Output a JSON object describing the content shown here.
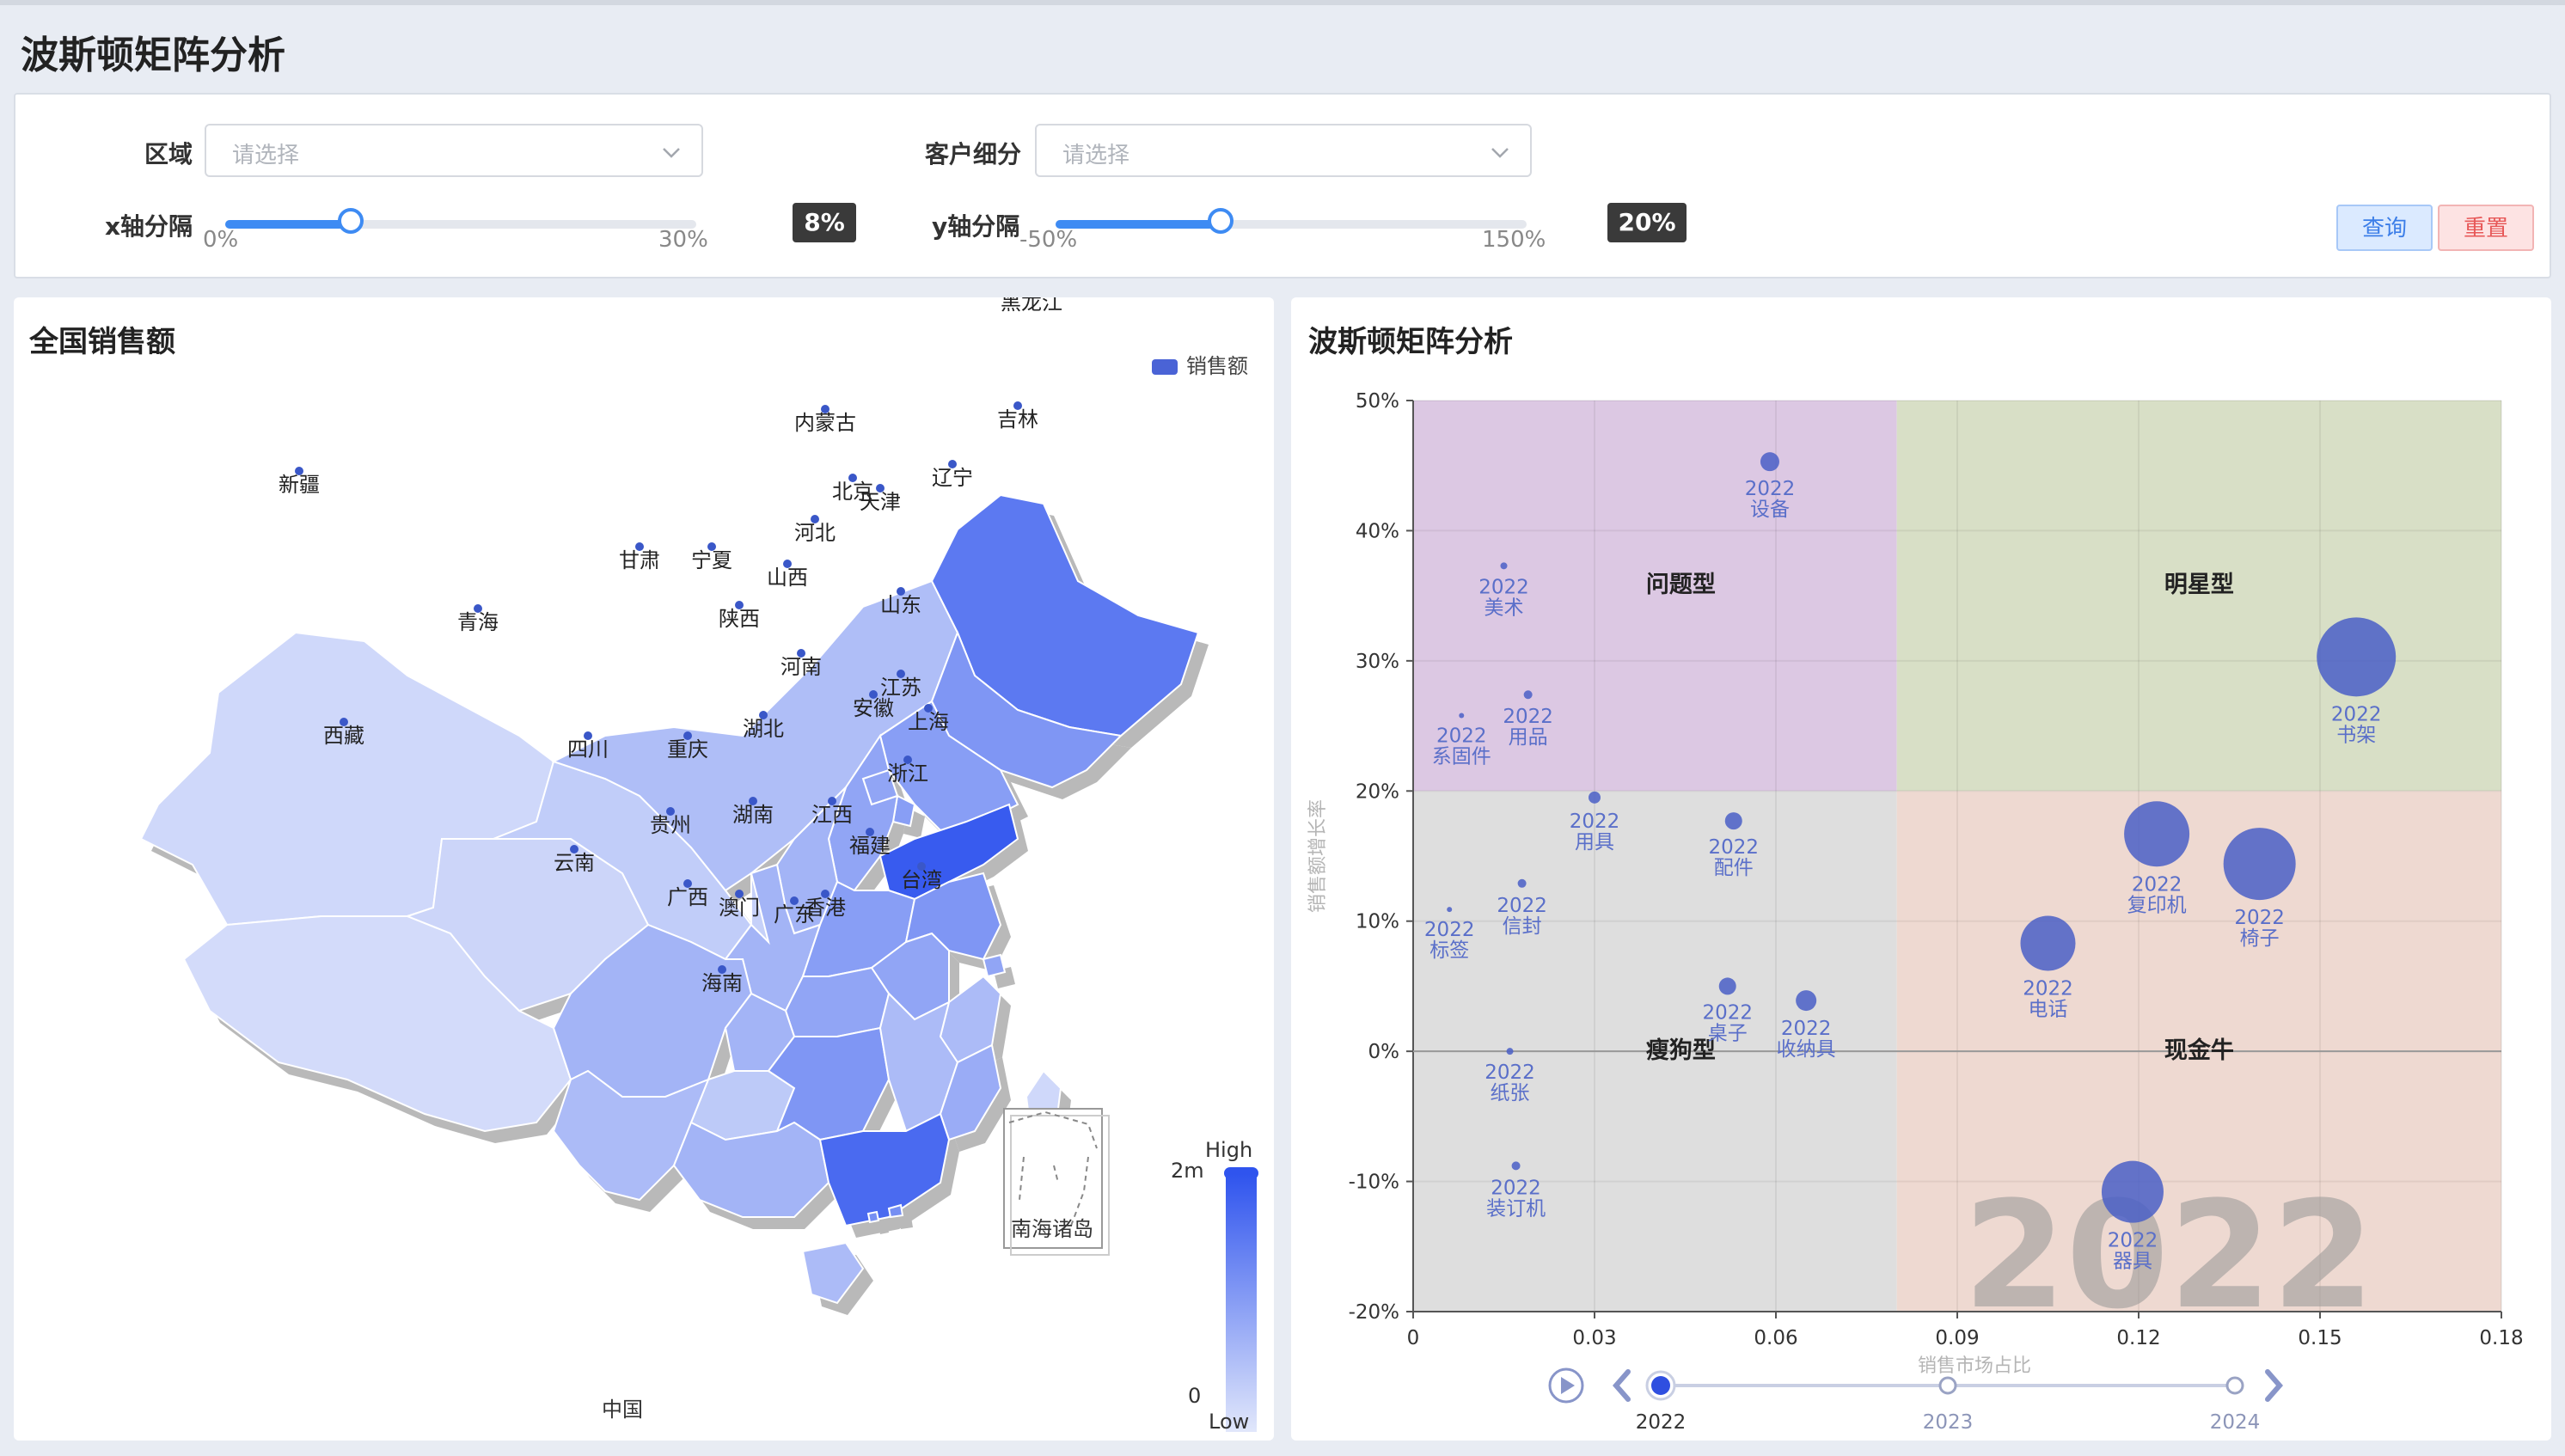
{
  "page": {
    "title": "波斯顿矩阵分析"
  },
  "filters": {
    "region": {
      "label": "区域",
      "placeholder": "请选择"
    },
    "segment": {
      "label": "客户细分",
      "placeholder": "请选择"
    },
    "x_interval": {
      "label": "x轴分隔",
      "min_label": "0%",
      "max_label": "30%",
      "value_label": "8%",
      "value_fraction": 0.267
    },
    "y_interval": {
      "label": "y轴分隔",
      "min_label": "-50%",
      "max_label": "150%",
      "value_label": "20%",
      "value_fraction": 0.35
    },
    "query_button": "查询",
    "reset_button": "重置"
  },
  "map_panel": {
    "title": "全国销售额",
    "legend_label": "销售额",
    "footer_label": "中国",
    "visual_map": {
      "high_label": "High",
      "low_label": "Low",
      "max_label": "2m",
      "min_label": "0",
      "colors": [
        "#e1e7fb",
        "#2f54ee"
      ]
    },
    "south_sea_label": "南海诸岛",
    "provinces": [
      {
        "name": "新疆",
        "level": 0.1
      },
      {
        "name": "西藏",
        "level": 0.08
      },
      {
        "name": "青海",
        "level": 0.12
      },
      {
        "name": "甘肃",
        "level": 0.18
      },
      {
        "name": "宁夏",
        "level": 0.15
      },
      {
        "name": "内蒙古",
        "level": 0.28
      },
      {
        "name": "黑龙江",
        "level": 0.75
      },
      {
        "name": "吉林",
        "level": 0.55
      },
      {
        "name": "辽宁",
        "level": 0.5
      },
      {
        "name": "北京",
        "level": 0.45
      },
      {
        "name": "天津",
        "level": 0.5
      },
      {
        "name": "河北",
        "level": 0.45
      },
      {
        "name": "山西",
        "level": 0.35
      },
      {
        "name": "陕西",
        "level": 0.35
      },
      {
        "name": "山东",
        "level": 0.95
      },
      {
        "name": "河南",
        "level": 0.5
      },
      {
        "name": "江苏",
        "level": 0.55
      },
      {
        "name": "安徽",
        "level": 0.45
      },
      {
        "name": "上海",
        "level": 0.45
      },
      {
        "name": "湖北",
        "level": 0.45
      },
      {
        "name": "四川",
        "level": 0.35
      },
      {
        "name": "重庆",
        "level": 0.35
      },
      {
        "name": "浙江",
        "level": 0.3
      },
      {
        "name": "贵州",
        "level": 0.2
      },
      {
        "name": "湖南",
        "level": 0.55
      },
      {
        "name": "江西",
        "level": 0.3
      },
      {
        "name": "云南",
        "level": 0.3
      },
      {
        "name": "福建",
        "level": 0.4
      },
      {
        "name": "广西",
        "level": 0.35
      },
      {
        "name": "广东",
        "level": 0.85
      },
      {
        "name": "香港",
        "level": 0.6
      },
      {
        "name": "澳门",
        "level": 0.6
      },
      {
        "name": "台湾",
        "level": 0.1
      },
      {
        "name": "海南",
        "level": 0.3
      }
    ]
  },
  "matrix_panel": {
    "title": "波斯顿矩阵分析"
  },
  "chart_data": {
    "type": "scatter",
    "xlabel": "销售市场占比",
    "ylabel": "销售额增长率",
    "xlim": [
      0,
      0.18
    ],
    "ylim": [
      -0.2,
      0.5
    ],
    "x_ticks": [
      "0",
      "0.03",
      "0.06",
      "0.09",
      "0.12",
      "0.15",
      "0.18"
    ],
    "y_ticks": [
      "-20%",
      "-10%",
      "0%",
      "10%",
      "20%",
      "30%",
      "40%",
      "50%"
    ],
    "x_split": 0.08,
    "y_split": 0.2,
    "quadrants": [
      {
        "name": "问题型",
        "color": "#dcc8e3"
      },
      {
        "name": "明星型",
        "color": "#d8dfc6"
      },
      {
        "name": "瘦狗型",
        "color": "#dedede"
      },
      {
        "name": "现金牛",
        "color": "#eed9d1"
      }
    ],
    "watermark": "2022",
    "timeline": {
      "years": [
        "2022",
        "2023",
        "2024"
      ],
      "current": "2022"
    },
    "points": [
      {
        "year": "2022",
        "name": "设备",
        "x": 0.059,
        "y": 0.453,
        "r": 11
      },
      {
        "year": "2022",
        "name": "美术",
        "x": 0.015,
        "y": 0.373,
        "r": 4
      },
      {
        "year": "2022",
        "name": "用品",
        "x": 0.019,
        "y": 0.274,
        "r": 5
      },
      {
        "year": "2022",
        "name": "系固件",
        "x": 0.008,
        "y": 0.258,
        "r": 3
      },
      {
        "year": "2022",
        "name": "书架",
        "x": 0.156,
        "y": 0.303,
        "r": 46
      },
      {
        "year": "2022",
        "name": "用具",
        "x": 0.03,
        "y": 0.195,
        "r": 7
      },
      {
        "year": "2022",
        "name": "配件",
        "x": 0.053,
        "y": 0.177,
        "r": 10
      },
      {
        "year": "2022",
        "name": "信封",
        "x": 0.018,
        "y": 0.129,
        "r": 5
      },
      {
        "year": "2022",
        "name": "标签",
        "x": 0.006,
        "y": 0.109,
        "r": 3
      },
      {
        "year": "2022",
        "name": "复印机",
        "x": 0.123,
        "y": 0.167,
        "r": 38
      },
      {
        "year": "2022",
        "name": "椅子",
        "x": 0.14,
        "y": 0.144,
        "r": 42
      },
      {
        "year": "2022",
        "name": "电话",
        "x": 0.105,
        "y": 0.083,
        "r": 32
      },
      {
        "year": "2022",
        "name": "桌子",
        "x": 0.052,
        "y": 0.05,
        "r": 10
      },
      {
        "year": "2022",
        "name": "收纳具",
        "x": 0.065,
        "y": 0.039,
        "r": 12
      },
      {
        "year": "2022",
        "name": "纸张",
        "x": 0.016,
        "y": 0.0,
        "r": 4
      },
      {
        "year": "2022",
        "name": "装订机",
        "x": 0.017,
        "y": -0.088,
        "r": 5
      },
      {
        "year": "2022",
        "name": "器具",
        "x": 0.119,
        "y": -0.108,
        "r": 36
      }
    ]
  }
}
